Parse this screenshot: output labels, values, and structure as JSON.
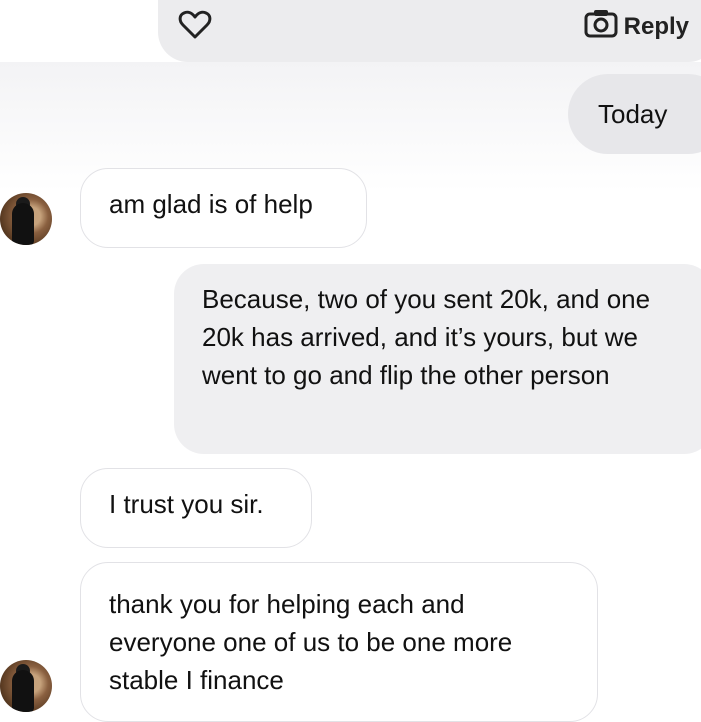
{
  "header": {
    "heart_icon": "heart-icon",
    "camera_icon": "camera-icon",
    "reply_label": "Reply"
  },
  "date_separator": "Today",
  "messages": [
    {
      "from": "them",
      "text": "am glad is of help"
    },
    {
      "from": "me",
      "text": "Because, two of you sent 20k, and one 20k has arrived, and it’s yours, but we went to go and flip the other person"
    },
    {
      "from": "them",
      "text": "I trust you sir."
    },
    {
      "from": "them",
      "text": "thank you for helping each and everyone one of us to be one more stable I  finance"
    }
  ],
  "colors": {
    "incoming_bubble": "#ffffff",
    "outgoing_bubble": "#efeff1",
    "header_bar": "#ececee"
  }
}
